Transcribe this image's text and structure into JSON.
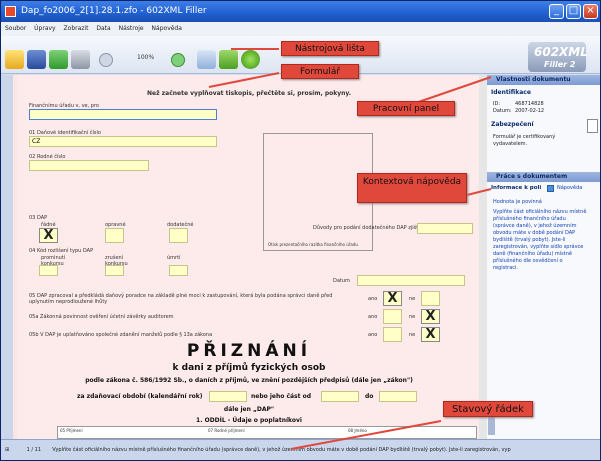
{
  "window": {
    "title": "Dap_fo2006_2[1].28.1.zfo - 602XML Filler"
  },
  "menu": [
    "Soubor",
    "Úpravy",
    "Zobrazit",
    "Data",
    "Nástroje",
    "Nápověda"
  ],
  "toolbar": {
    "zoom": "100%"
  },
  "logo": {
    "main": "602XML",
    "sub": "Filler 2"
  },
  "callouts": {
    "toolbar": "Nástrojová lišta",
    "form": "Formulář",
    "panel": "Pracovní panel",
    "context": "Kontextová nápověda",
    "status": "Stavový řádek"
  },
  "form": {
    "instruction": "Než začnete vyplňovat tiskopis, přečtěte si, prosím, pokyny.",
    "office_label": "Finančnímu úřadu v, ve, pro",
    "dic_label": "01 Daňové identifikační číslo",
    "dic_value": "CZ",
    "rc_label": "02 Rodné číslo",
    "stamp_label": "Otisk prezentačního razítka finančního úřadu",
    "dap_label": "03 DAP",
    "dap_opts": [
      "řádné",
      "opravné",
      "dodatečné"
    ],
    "reason_label": "Důvody pro podání dodatečného DAP zjištěny dne",
    "kind_label": "04 Kód rozlišení typu DAP",
    "kind_opts": [
      "prominutí konkursu",
      "zrušení konkursu",
      "úmrtí"
    ],
    "date_label": "Datum",
    "q35": "05 DAP zpracoval a předkládá daňový poradce na základě plné moci k zastupování, která byla podána správci daně před uplynutím neprodloužené lhůty",
    "q35a": "05a Zákonná povinnost ověření účetní závěrky auditorem",
    "q05b": "05b V DAP je uplatňováno společné zdanění manželů podle § 13a zákona",
    "yes": "ano",
    "no": "ne",
    "title": "PŘIZNÁNÍ",
    "subtitle": "k dani z příjmů fyzických osob",
    "law": "podle zákona č. 586/1992 Sb., o daních z příjmů, ve znění pozdějších předpisů (dále jen „zákon\")",
    "period_label": "za zdaňovací období (kalendářní rok)",
    "or_label": "nebo jeho část od",
    "to_label": "do",
    "further": "dále jen „DAP\"",
    "section1": "1. ODDÍL - Údaje o poplatníkovi",
    "col1": "05 Příjmení",
    "col2": "07 Rodné příjmení",
    "col3": "08 Jméno"
  },
  "panel": {
    "props_header": "Vlastnosti dokumentu",
    "ident_header": "Identifikace",
    "id_label": "ID:",
    "id_value": "468714828",
    "date_label": "Datum:",
    "date_value": "2007-02-12",
    "sec_header": "Zabezpečení",
    "sec_text": [
      "Formulář je certifikovaný",
      "vydavatelem."
    ],
    "work_header": "Práce s dokumentem",
    "info_header": "Informace k poli",
    "help_link": "Nápověda",
    "hint_title": "Hodnota je povinná",
    "hint_text": [
      "Vyplňte část oficiálního názvu místně",
      "příslušného finančního úřadu",
      "(správce daně), v jehož územním",
      "obvodu máte v době podání DAP",
      "bydliště (trvalý pobyt). Jste-li",
      "zaregistrován, vyplňte sídlo správce",
      "daně (finančního úřadu) místně",
      "příslušného dle osvědčení o",
      "registraci."
    ]
  },
  "status": {
    "page": "1 / 11",
    "text": "Vyplňte část oficiálního názvu místně příslušného finančního úřadu (správce daně), v jehož územním obvodu máte v době podání DAP bydliště (trvalý pobyt). Jste-li zaregistrován, vyp"
  }
}
